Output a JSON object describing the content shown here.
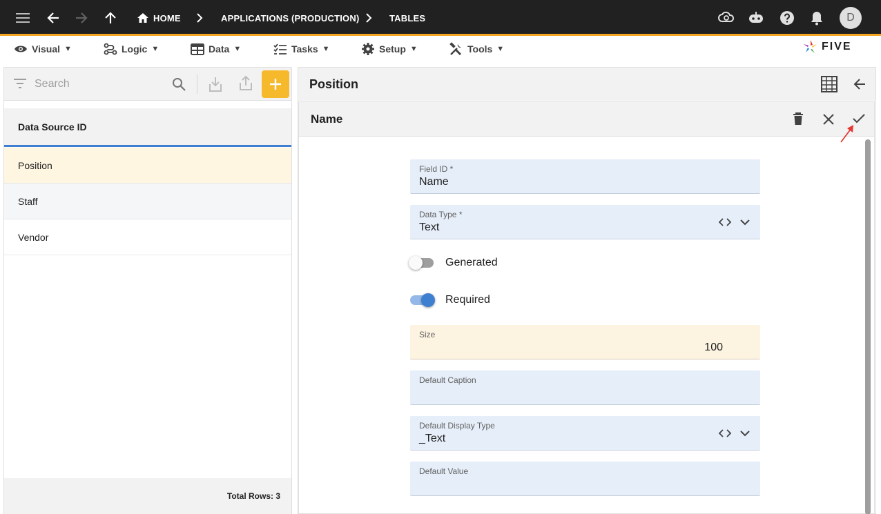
{
  "breadcrumb": {
    "home": "HOME",
    "app": "APPLICATIONS (PRODUCTION)",
    "tables": "TABLES"
  },
  "user": {
    "avatar_initial": "D"
  },
  "menu": {
    "items": [
      {
        "label": "Visual",
        "icon": "eye-icon"
      },
      {
        "label": "Logic",
        "icon": "logic-icon"
      },
      {
        "label": "Data",
        "icon": "table-icon"
      },
      {
        "label": "Tasks",
        "icon": "tasks-icon"
      },
      {
        "label": "Setup",
        "icon": "gear-icon"
      },
      {
        "label": "Tools",
        "icon": "tools-icon"
      }
    ],
    "logo_text": "FIVE"
  },
  "list": {
    "search_placeholder": "Search",
    "column_header": "Data Source ID",
    "rows": [
      {
        "label": "Position",
        "selected": true
      },
      {
        "label": "Staff",
        "selected": false
      },
      {
        "label": "Vendor",
        "selected": false
      }
    ],
    "total_rows": "Total Rows: 3"
  },
  "detail": {
    "title": "Position",
    "form_title": "Name",
    "fields": {
      "field_id": {
        "label": "Field ID *",
        "value": "Name"
      },
      "data_type": {
        "label": "Data Type *",
        "value": "Text"
      },
      "generated": {
        "label": "Generated",
        "checked": false
      },
      "required": {
        "label": "Required",
        "checked": true
      },
      "size": {
        "label": "Size",
        "value": "100"
      },
      "default_caption": {
        "label": "Default Caption",
        "value": ""
      },
      "default_display_type": {
        "label": "Default Display Type",
        "value": "_Text"
      },
      "default_value": {
        "label": "Default Value",
        "value": ""
      }
    }
  },
  "colors": {
    "topbar": "#212121",
    "accent": "#f6b92b",
    "selected_row": "#fff6e2",
    "field_bg": "#e6eef9",
    "toggle_on": "#3f7fcf"
  }
}
